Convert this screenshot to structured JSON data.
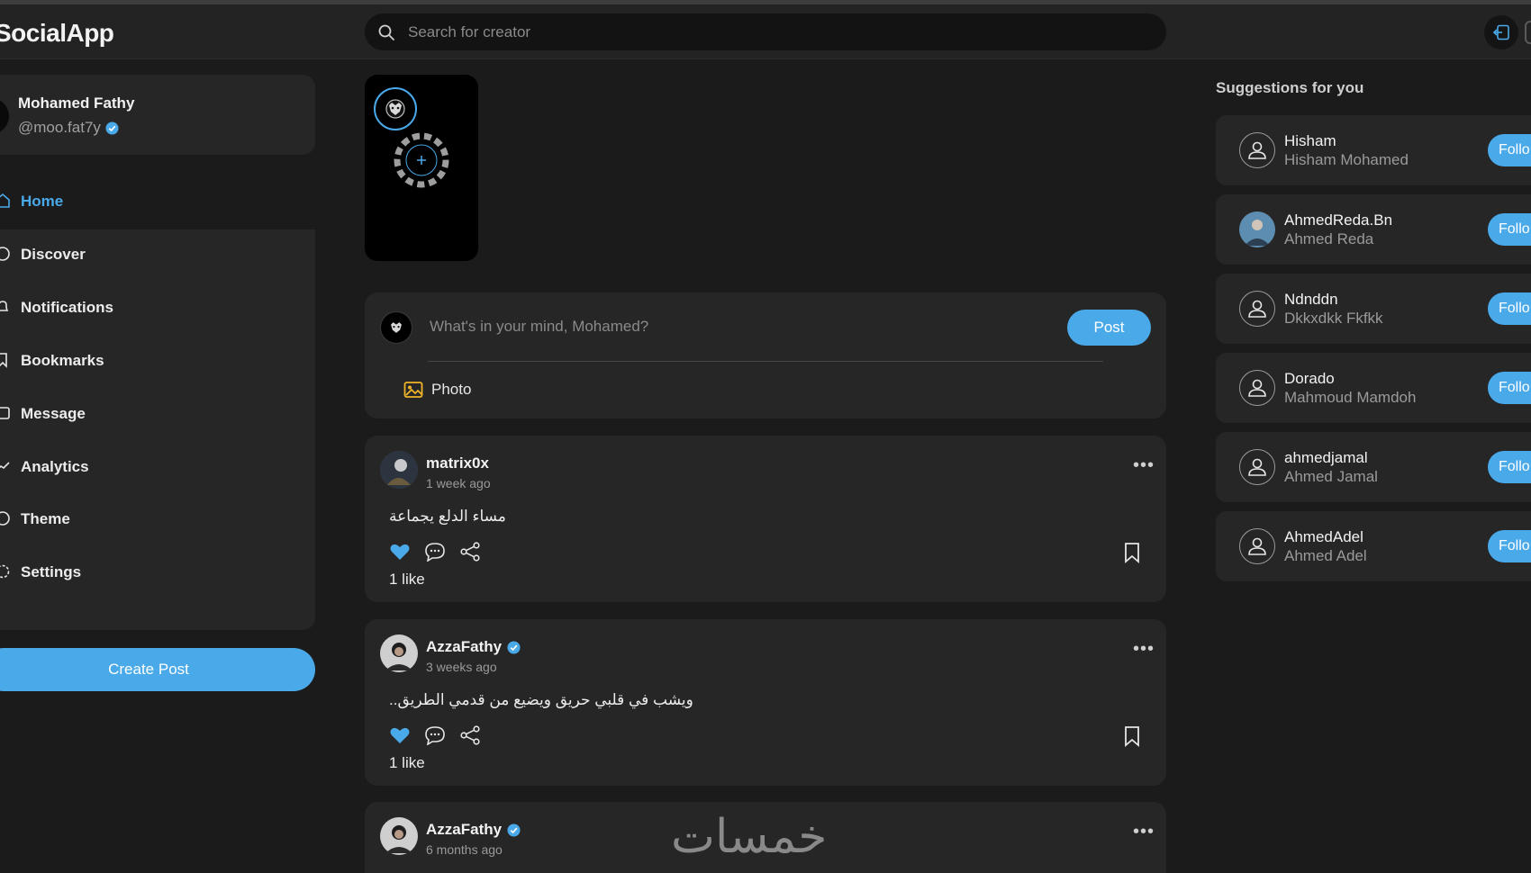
{
  "app": {
    "title": "SocialApp"
  },
  "search": {
    "placeholder": "Search for creator"
  },
  "profile": {
    "name": "Mohamed Fathy",
    "handle": "@moo.fat7y"
  },
  "nav": {
    "items": [
      {
        "label": "Home",
        "icon": "home-icon",
        "active": true
      },
      {
        "label": "Discover",
        "icon": "compass-icon"
      },
      {
        "label": "Notifications",
        "icon": "bell-icon"
      },
      {
        "label": "Bookmarks",
        "icon": "bookmark-icon"
      },
      {
        "label": "Message",
        "icon": "message-icon"
      },
      {
        "label": "Analytics",
        "icon": "analytics-icon"
      },
      {
        "label": "Theme",
        "icon": "palette-icon"
      },
      {
        "label": "Settings",
        "icon": "gear-icon"
      }
    ],
    "create_post_label": "Create Post"
  },
  "composer": {
    "placeholder": "What's in your mind, Mohamed?",
    "post_label": "Post",
    "photo_label": "Photo"
  },
  "posts": [
    {
      "author": "matrix0x",
      "verified": false,
      "time": "1 week ago",
      "text": "مساء الدلع يجماعة",
      "likes": "1 like"
    },
    {
      "author": "AzzaFathy",
      "verified": true,
      "time": "3 weeks ago",
      "text": "ويشب في قلبي حريق ويضيع من قدمي الطريق..",
      "likes": "1 like"
    },
    {
      "author": "AzzaFathy",
      "verified": true,
      "time": "6 months ago",
      "text": "",
      "likes": ""
    }
  ],
  "suggestions": {
    "title": "Suggestions for you",
    "follow_label": "Follo",
    "items": [
      {
        "username": "Hisham",
        "name": "Hisham Mohamed"
      },
      {
        "username": "AhmedReda.Bn",
        "name": "Ahmed Reda"
      },
      {
        "username": "Ndnddn",
        "name": "Dkkxdkk Fkfkk"
      },
      {
        "username": "Dorado",
        "name": "Mahmoud Mamdoh"
      },
      {
        "username": "ahmedjamal",
        "name": "Ahmed Jamal"
      },
      {
        "username": "AhmedAdel",
        "name": "Ahmed Adel"
      }
    ]
  },
  "watermark": "خمسات",
  "colors": {
    "accent": "#4aa9e9",
    "background": "#1b1b1b",
    "card": "#262626",
    "header": "#232323",
    "photo_icon": "#f0b429"
  }
}
